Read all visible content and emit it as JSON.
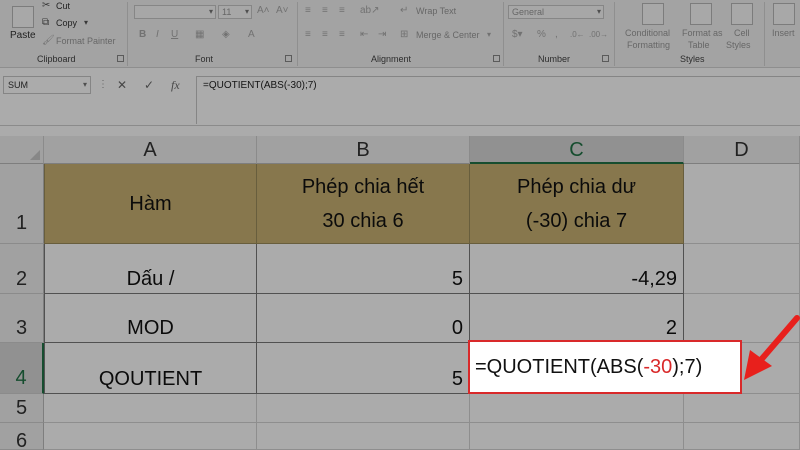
{
  "ribbon": {
    "clipboard": {
      "label": "Clipboard",
      "paste": "Paste",
      "cut": "Cut",
      "copy": "Copy",
      "format_painter": "Format Painter"
    },
    "font": {
      "label": "Font",
      "size": "11"
    },
    "alignment": {
      "label": "Alignment",
      "wrap_text": "Wrap Text",
      "merge_center": "Merge & Center"
    },
    "number": {
      "label": "Number",
      "format": "General"
    },
    "styles": {
      "label": "Styles",
      "conditional_formatting_1": "Conditional",
      "conditional_formatting_2": "Formatting",
      "format_as_table_1": "Format as",
      "format_as_table_2": "Table",
      "cell_styles_1": "Cell",
      "cell_styles_2": "Styles"
    },
    "cells": {
      "insert": "Insert"
    }
  },
  "formula_bar": {
    "name_box": "SUM",
    "cancel_icon": "✕",
    "enter_icon": "✓",
    "fx": "fx",
    "formula": "=QUOTIENT(ABS(-30);7)"
  },
  "grid": {
    "columns": [
      "A",
      "B",
      "C",
      "D"
    ],
    "rows": [
      "1",
      "2",
      "3",
      "4",
      "5",
      "6"
    ],
    "header_row": {
      "a": "Hàm",
      "b_line1": "Phép chia hết",
      "b_line2": "30 chia 6",
      "c_line1": "Phép chia dư",
      "c_line2": "(-30) chia 7"
    },
    "row2": {
      "a": "Dấu /",
      "b": "5",
      "c": "-4,29"
    },
    "row3": {
      "a": "MOD",
      "b": "0",
      "c": "2"
    },
    "row4": {
      "a": "QOUTIENT",
      "b": "5"
    },
    "editing": {
      "part1": "=QUOTIENT(ABS(",
      "part2": "-30",
      "part3": ");7)"
    }
  },
  "colors": {
    "header_fill": "#c9b273",
    "highlight": "#d9292a",
    "excel_green": "#217346"
  }
}
